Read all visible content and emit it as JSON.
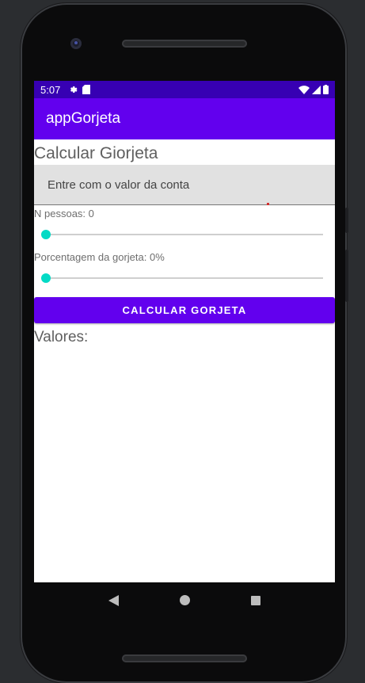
{
  "status_bar": {
    "time": "5:07",
    "icons_left": [
      "gear-icon",
      "sd-card-icon"
    ],
    "icons_right": [
      "wifi-icon",
      "signal-icon",
      "battery-icon"
    ]
  },
  "app_bar": {
    "title": "appGorjeta"
  },
  "main": {
    "title": "Calcular Giorjeta",
    "bill_input": {
      "placeholder": "Entre com o valor da conta",
      "value": ""
    },
    "people_label": "N pessoas: 0",
    "people_slider": {
      "value": 0,
      "min": 0
    },
    "percent_label": "Porcentagem da gorjeta: 0%",
    "percent_slider": {
      "value": 0,
      "min": 0
    },
    "button_label": "CALCULAR GORJETA",
    "result_label": "Valores:"
  },
  "colors": {
    "primary": "#6200ee",
    "primary_dark": "#3700b3",
    "accent": "#03dac5"
  }
}
